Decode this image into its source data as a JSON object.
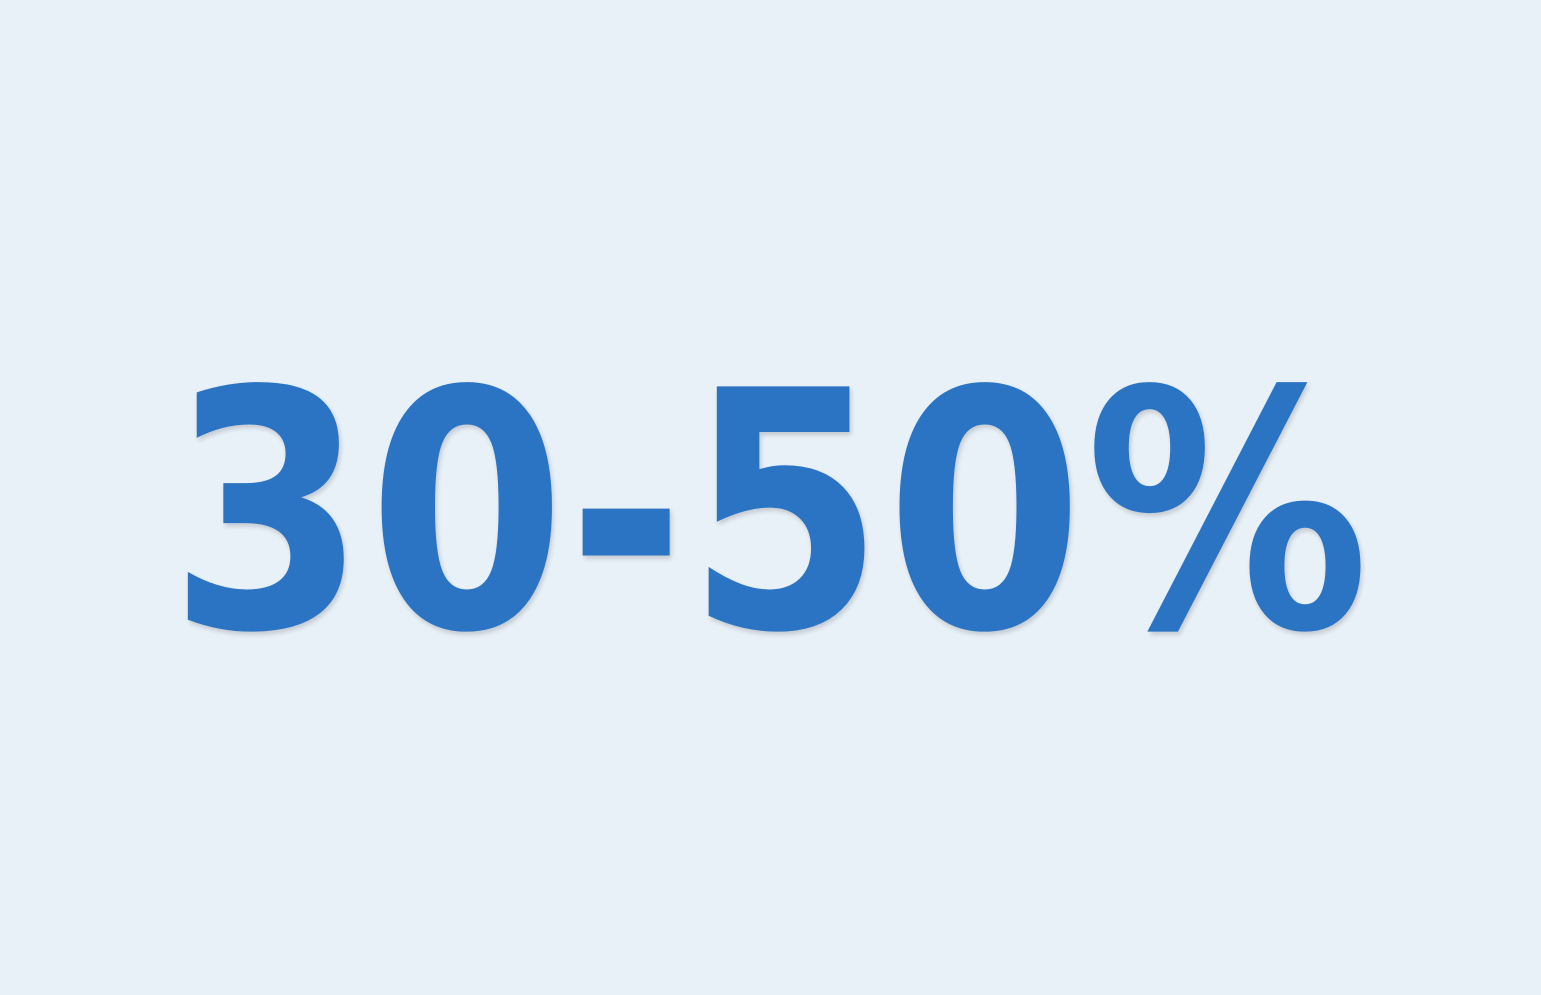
{
  "hero": {
    "stat_text": "30-50%"
  },
  "colors": {
    "background": "#e8f0f8",
    "stat_text": "#2b74c4"
  }
}
